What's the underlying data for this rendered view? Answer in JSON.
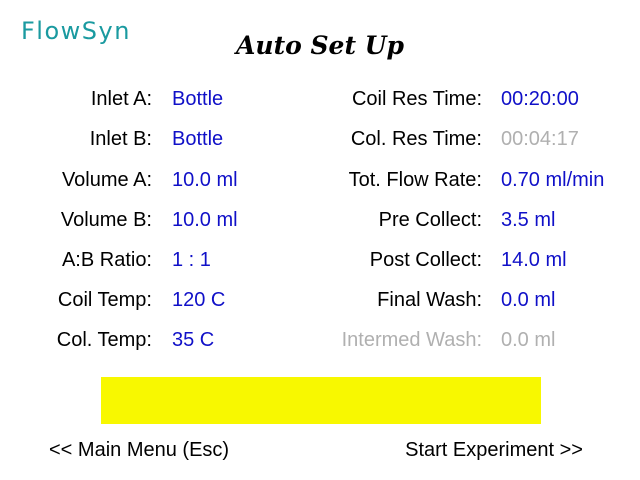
{
  "brand": "FlowSyn",
  "title": "Auto Set Up",
  "left_params": [
    {
      "label": "Inlet A:",
      "value": "Bottle"
    },
    {
      "label": "Inlet B:",
      "value": "Bottle"
    },
    {
      "label": "Volume A:",
      "value": "10.0 ml"
    },
    {
      "label": "Volume B:",
      "value": "10.0 ml"
    },
    {
      "label": "A:B Ratio:",
      "value": "1 : 1"
    },
    {
      "label": "Coil Temp:",
      "value": "120 C"
    },
    {
      "label": "Col. Temp:",
      "value": "35 C"
    }
  ],
  "right_params": [
    {
      "label": "Coil Res Time:",
      "value": "00:20:00"
    },
    {
      "label": "Col. Res Time:",
      "value": "00:04:17",
      "disabled": true
    },
    {
      "label": "Tot. Flow Rate:",
      "value": "0.70 ml/min"
    },
    {
      "label": "Pre Collect:",
      "value": "3.5 ml"
    },
    {
      "label": "Post Collect:",
      "value": "14.0 ml"
    },
    {
      "label": "Final Wash:",
      "value": "0.0 ml"
    },
    {
      "label": "Intermed Wash:",
      "value": "0.0 ml",
      "disabled": true
    }
  ],
  "status_message": "",
  "nav": {
    "back_label": "<< Main Menu (Esc)",
    "next_label": "Start Experiment >>"
  },
  "colors": {
    "brand": "#1a9aa0",
    "value": "#1010c8",
    "disabled": "#b0b0b0",
    "status_bar": "#f8f800"
  }
}
